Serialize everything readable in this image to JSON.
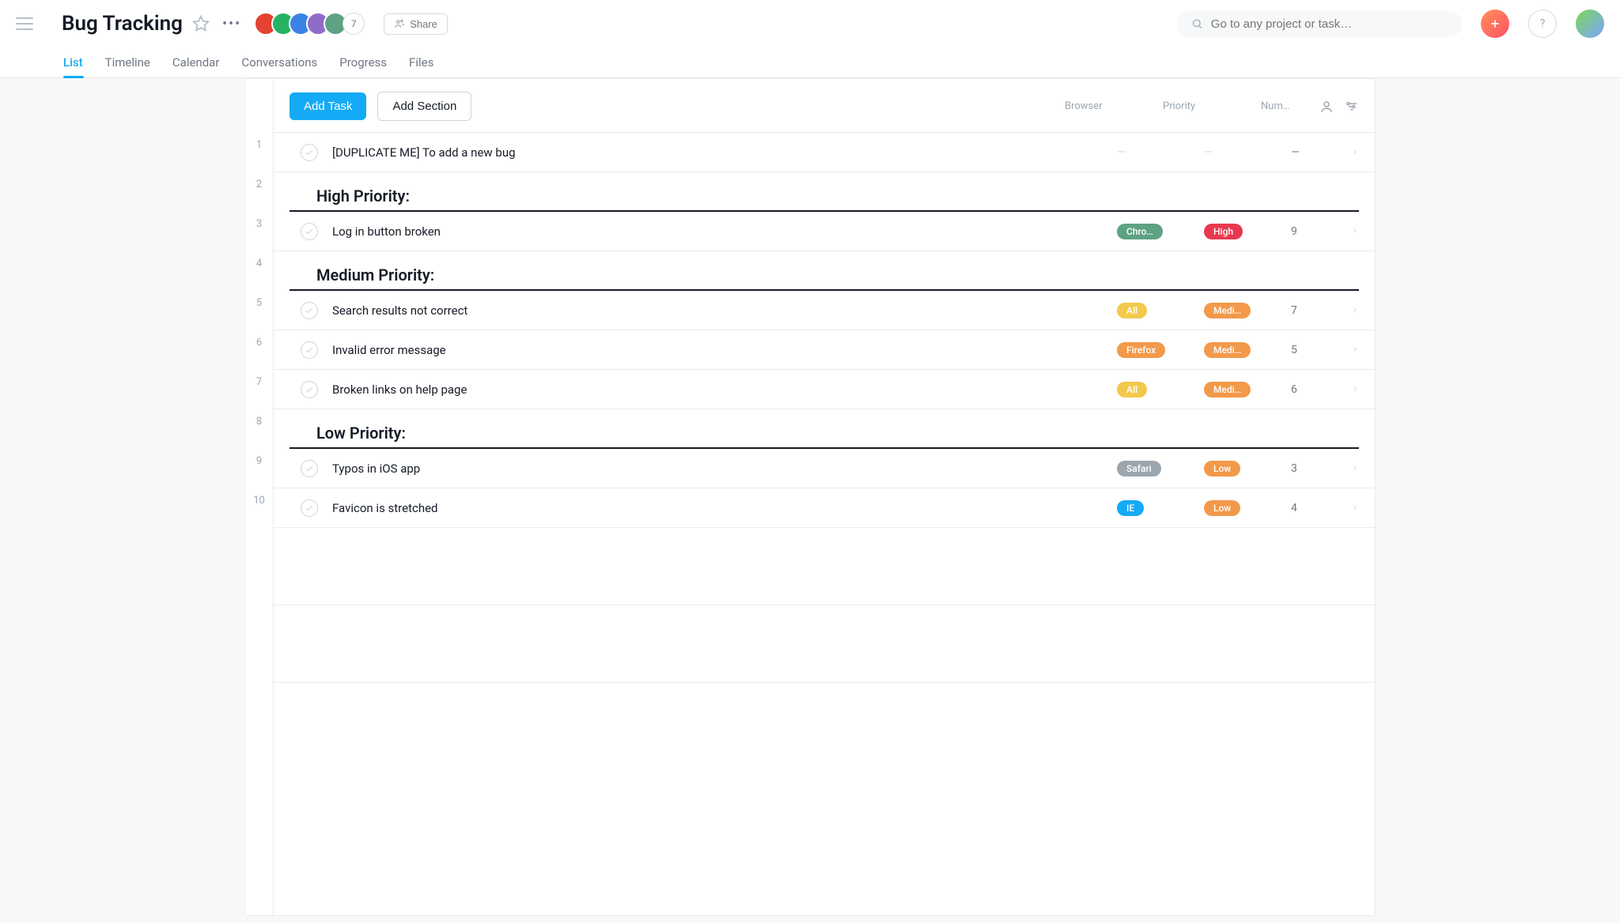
{
  "header": {
    "project_title": "Bug Tracking",
    "member_overflow": "7",
    "share_label": "Share",
    "search_placeholder": "Go to any project or task…"
  },
  "tabs": {
    "list": "List",
    "timeline": "Timeline",
    "calendar": "Calendar",
    "conversations": "Conversations",
    "progress": "Progress",
    "files": "Files"
  },
  "toolbar": {
    "add_task_label": "Add Task",
    "add_section_label": "Add Section",
    "col_browser": "Browser",
    "col_priority": "Priority",
    "col_number": "Num…"
  },
  "rows": [
    {
      "n": "1",
      "type": "task",
      "title": "[DUPLICATE ME] To add a new bug",
      "browser": "",
      "browser_color": "",
      "priority": "",
      "priority_color": "",
      "num": ""
    },
    {
      "n": "2",
      "type": "section",
      "title": "High Priority:"
    },
    {
      "n": "3",
      "type": "task",
      "title": "Log in button broken",
      "browser": "Chro…",
      "browser_color": "green",
      "priority": "High",
      "priority_color": "red",
      "num": "9"
    },
    {
      "n": "4",
      "type": "section",
      "title": "Medium Priority:"
    },
    {
      "n": "5",
      "type": "task",
      "title": "Search results not correct",
      "browser": "All",
      "browser_color": "yellow",
      "priority": "Medi…",
      "priority_color": "orange",
      "num": "7"
    },
    {
      "n": "6",
      "type": "task",
      "title": "Invalid error message",
      "browser": "Firefox",
      "browser_color": "orange",
      "priority": "Medi…",
      "priority_color": "orange",
      "num": "5"
    },
    {
      "n": "7",
      "type": "task",
      "title": "Broken links on help page",
      "browser": "All",
      "browser_color": "yellow",
      "priority": "Medi…",
      "priority_color": "orange",
      "num": "6"
    },
    {
      "n": "8",
      "type": "section",
      "title": "Low Priority:"
    },
    {
      "n": "9",
      "type": "task",
      "title": "Typos in iOS app",
      "browser": "Safari",
      "browser_color": "gray",
      "priority": "Low",
      "priority_color": "orange",
      "num": "3"
    },
    {
      "n": "10",
      "type": "task",
      "title": "Favicon is stretched",
      "browser": "IE",
      "browser_color": "blue",
      "priority": "Low",
      "priority_color": "orange",
      "num": "4"
    }
  ]
}
